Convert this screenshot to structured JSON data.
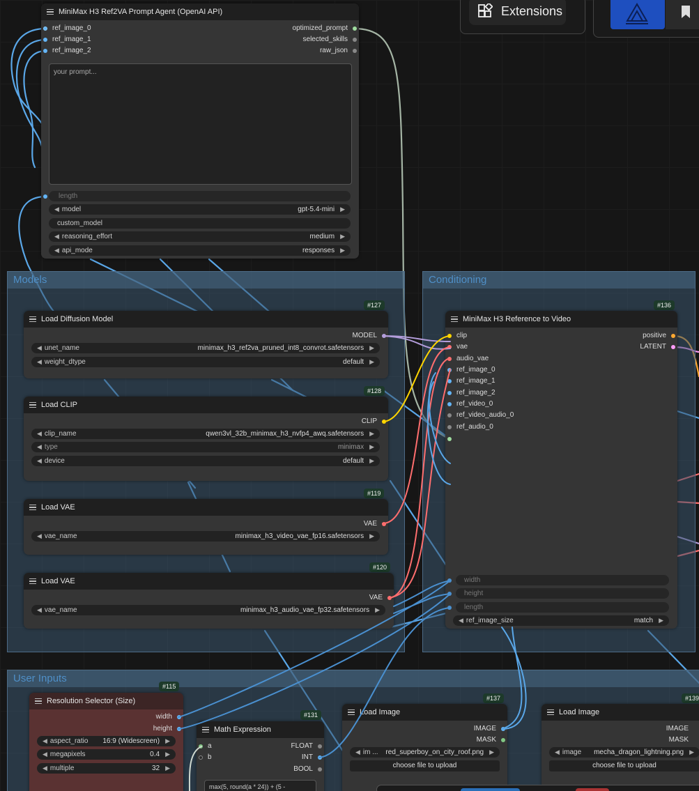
{
  "topbar": {
    "extensions_label": "Extensions"
  },
  "groups": {
    "models": "Models",
    "conditioning": "Conditioning",
    "user_inputs": "User Inputs"
  },
  "prompt_agent": {
    "title": "MiniMax H3 Ref2VA Prompt Agent (OpenAI API)",
    "inputs": [
      "ref_image_0",
      "ref_image_1",
      "ref_image_2"
    ],
    "outputs": [
      "optimized_prompt",
      "selected_skills",
      "raw_json"
    ],
    "placeholder": "your prompt...",
    "length_label": "length",
    "model_label": "model",
    "model_value": "gpt-5.4-mini",
    "custom_model_label": "custom_model",
    "reasoning_label": "reasoning_effort",
    "reasoning_value": "medium",
    "api_mode_label": "api_mode",
    "api_mode_value": "responses"
  },
  "diffusion": {
    "id": "#127",
    "title": "Load Diffusion Model",
    "output": "MODEL",
    "unet_label": "unet_name",
    "unet_value": "minimax_h3_ref2va_pruned_int8_convrot.safetensors",
    "dtype_label": "weight_dtype",
    "dtype_value": "default"
  },
  "clip": {
    "id": "#128",
    "title": "Load CLIP",
    "output": "CLIP",
    "clip_name_label": "clip_name",
    "clip_name_value": "qwen3vl_32b_minimax_h3_nvfp4_awq.safetensors",
    "type_label": "type",
    "type_value": "minimax",
    "device_label": "device",
    "device_value": "default"
  },
  "vae_video": {
    "id": "#119",
    "title": "Load VAE",
    "output": "VAE",
    "vae_label": "vae_name",
    "vae_value": "minimax_h3_video_vae_fp16.safetensors"
  },
  "vae_audio": {
    "id": "#120",
    "title": "Load VAE",
    "output": "VAE",
    "vae_label": "vae_name",
    "vae_value": "minimax_h3_audio_vae_fp32.safetensors"
  },
  "ref2video": {
    "id": "#136",
    "title": "MiniMax H3 Reference to Video",
    "inputs": [
      "clip",
      "vae",
      "audio_vae",
      "ref_image_0",
      "ref_image_1",
      "ref_image_2",
      "ref_video_0",
      "ref_video_audio_0",
      "ref_audio_0"
    ],
    "outputs": [
      "positive",
      "LATENT"
    ],
    "width_label": "width",
    "height_label": "height",
    "length_label": "length",
    "ref_size_label": "ref_image_size",
    "ref_size_value": "match"
  },
  "resolution": {
    "id": "#115",
    "title": "Resolution Selector (Size)",
    "outputs": [
      "width",
      "height"
    ],
    "aspect_label": "aspect_ratio",
    "aspect_value": "16:9 (Widescreen)",
    "mp_label": "megapixels",
    "mp_value": "0.4",
    "multiple_label": "multiple",
    "multiple_value": "32"
  },
  "math": {
    "id": "#131",
    "title": "Math Expression",
    "inputs": [
      "a",
      "b"
    ],
    "outputs": [
      "FLOAT",
      "INT",
      "BOOL"
    ],
    "expression": "max(5, round(a * 24)) + (5 -"
  },
  "load_image_1": {
    "id": "#137",
    "title": "Load Image",
    "outputs": [
      "IMAGE",
      "MASK"
    ],
    "image_label": "im ...",
    "image_value": "red_superboy_on_city_roof.png",
    "upload_label": "choose file to upload"
  },
  "load_image_2": {
    "id": "#139",
    "title": "Load Image",
    "outputs": [
      "IMAGE",
      "MASK"
    ],
    "image_label": "image",
    "image_value": "mecha_dragon_lightning.png",
    "upload_label": "choose file to upload"
  },
  "colors": {
    "model": "#b39ddb",
    "clip": "#ffd500",
    "vae": "#ff6e6e",
    "image": "#64b5f6",
    "int": "#64b5f6",
    "latent": "#ff9cf9",
    "conditioning": "#ffa931",
    "string": "#9fdc9f",
    "mask": "#81c784"
  }
}
